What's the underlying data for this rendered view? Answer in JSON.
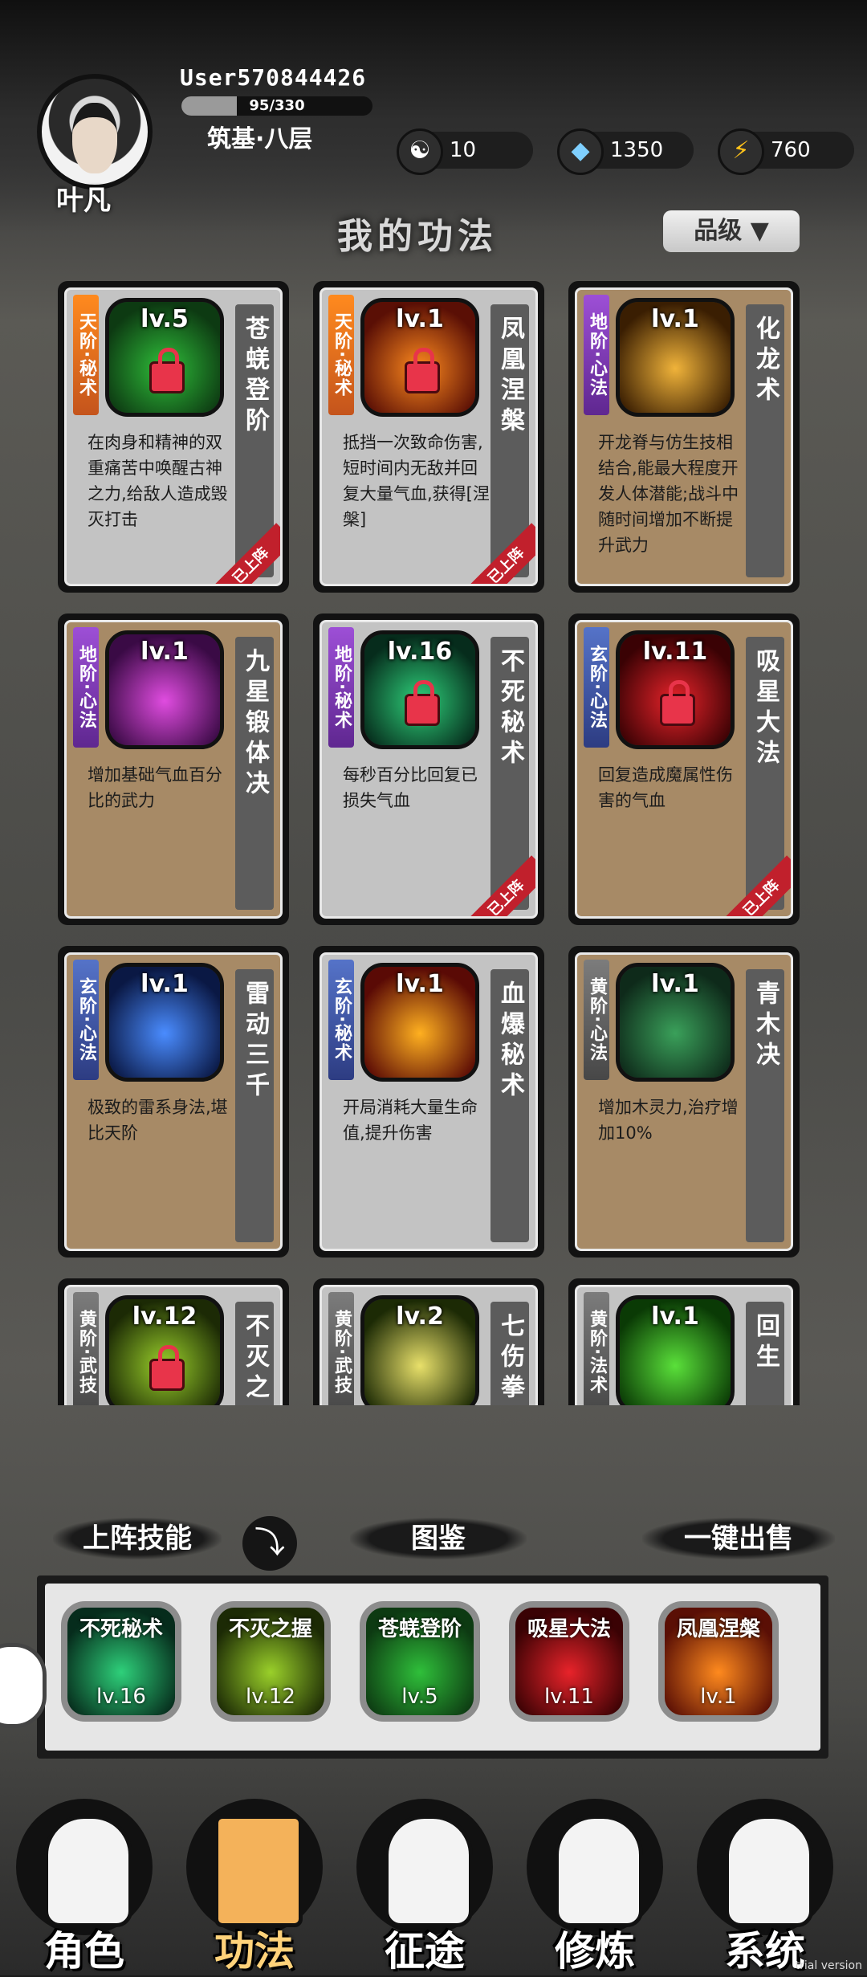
{
  "player": {
    "name": "叶凡",
    "user_id": "User570844426",
    "xp_text": "95/330",
    "xp_progress": 0.288,
    "realm": "筑基·八层"
  },
  "resources": [
    {
      "icon": "yin-yang-icon",
      "value": "10"
    },
    {
      "icon": "crystal-icon",
      "value": "1350"
    },
    {
      "icon": "lightning-icon",
      "value": "760"
    }
  ],
  "page_title": "我的功法",
  "grade_filter": "品级",
  "cards": [
    {
      "ribbon": "天阶·秘术",
      "tier": "tian",
      "level": "lv.5",
      "name": "苍蜣登阶",
      "desc": "在肉身和精神的双重痛苦中唤醒古神之力,给敌人造成毁灭打击",
      "bg": "gray",
      "locked": true,
      "equipped": true,
      "art": [
        "#0d3a12",
        "#2fbf3a"
      ]
    },
    {
      "ribbon": "天阶·秘术",
      "tier": "tian",
      "level": "lv.1",
      "name": "凤凰涅槃",
      "desc": "抵挡一次致命伤害,短时间内无敌并回复大量气血,获得[涅槃]",
      "bg": "gray",
      "locked": true,
      "equipped": true,
      "art": [
        "#5a0f05",
        "#ff8a1e"
      ]
    },
    {
      "ribbon": "地阶·心法",
      "tier": "di",
      "level": "lv.1",
      "name": "化龙术",
      "desc": "开龙脊与仿生技相结合,能最大程度开发人体潜能;战斗中随时间增加不断提升武力",
      "bg": "tan",
      "locked": false,
      "equipped": false,
      "art": [
        "#3a1e02",
        "#f0b33a"
      ]
    },
    {
      "ribbon": "地阶·心法",
      "tier": "di",
      "level": "lv.1",
      "name": "九星锻体决",
      "desc": "增加基础气血百分比的武力",
      "bg": "tan",
      "locked": false,
      "equipped": false,
      "art": [
        "#3a0a45",
        "#e04ce0"
      ]
    },
    {
      "ribbon": "地阶·秘术",
      "tier": "di",
      "level": "lv.16",
      "name": "不死秘术",
      "desc": "每秒百分比回复已损失气血",
      "bg": "gray",
      "locked": true,
      "equipped": true,
      "art": [
        "#062c1c",
        "#2ed07a"
      ]
    },
    {
      "ribbon": "玄阶·心法",
      "tier": "xuan",
      "level": "lv.11",
      "name": "吸星大法",
      "desc": "回复造成魔属性伤害的气血",
      "bg": "tan",
      "locked": true,
      "equipped": true,
      "art": [
        "#3a0204",
        "#e8232a"
      ]
    },
    {
      "ribbon": "玄阶·心法",
      "tier": "xuan",
      "level": "lv.1",
      "name": "雷动三千",
      "desc": "极致的雷系身法,堪比天阶",
      "bg": "tan",
      "locked": false,
      "equipped": false,
      "art": [
        "#0a1844",
        "#4a8cff"
      ]
    },
    {
      "ribbon": "玄阶·秘术",
      "tier": "xuan",
      "level": "lv.1",
      "name": "血爆秘术",
      "desc": "开局消耗大量生命值,提升伤害",
      "bg": "gray",
      "locked": false,
      "equipped": false,
      "art": [
        "#5a0a05",
        "#ffb020"
      ]
    },
    {
      "ribbon": "黄阶·心法",
      "tier": "huang",
      "level": "lv.1",
      "name": "青木决",
      "desc": "增加木灵力,治疗增加10%",
      "bg": "tan",
      "locked": false,
      "equipped": false,
      "art": [
        "#0e2a1a",
        "#3aa05a"
      ]
    },
    {
      "ribbon": "黄阶·武技",
      "tier": "huang",
      "level": "lv.12",
      "name": "不灭之",
      "desc": "",
      "bg": "gray",
      "locked": true,
      "equipped": false,
      "art": [
        "#1c2a05",
        "#9ad02a"
      ]
    },
    {
      "ribbon": "黄阶·武技",
      "tier": "huang",
      "level": "lv.2",
      "name": "七伤拳",
      "desc": "",
      "bg": "gray",
      "locked": false,
      "equipped": false,
      "art": [
        "#1c2a05",
        "#e8e06a"
      ]
    },
    {
      "ribbon": "黄阶·法术",
      "tier": "huang",
      "level": "lv.1",
      "name": "回生",
      "desc": "",
      "bg": "gray",
      "locked": false,
      "equipped": false,
      "art": [
        "#0a3a05",
        "#5ae03a"
      ]
    }
  ],
  "tabs": {
    "equipped": "上阵技能",
    "gallery": "图鉴",
    "sell_all": "一键出售"
  },
  "equipped_skills": [
    {
      "name": "不死秘术",
      "level": "lv.16",
      "art": [
        "#062c1c",
        "#2ed07a"
      ]
    },
    {
      "name": "不灭之握",
      "level": "lv.12",
      "art": [
        "#1c2a05",
        "#9ad02a"
      ]
    },
    {
      "name": "苍蜣登阶",
      "level": "lv.5",
      "art": [
        "#0d3a12",
        "#2fbf3a"
      ]
    },
    {
      "name": "吸星大法",
      "level": "lv.11",
      "art": [
        "#3a0204",
        "#e8232a"
      ]
    },
    {
      "name": "凤凰涅槃",
      "level": "lv.1",
      "art": [
        "#5a0f05",
        "#ff8a1e"
      ]
    }
  ],
  "equipped_badge": "已上阵",
  "nav": [
    {
      "label": "角色",
      "icon": "hooded-figure-icon",
      "active": false
    },
    {
      "label": "功法",
      "icon": "scroll-book-icon",
      "active": true
    },
    {
      "label": "征途",
      "icon": "sword-emblem-icon",
      "active": false
    },
    {
      "label": "修炼",
      "icon": "meditating-figure-icon",
      "active": false
    },
    {
      "label": "系统",
      "icon": "mascot-icon",
      "active": false
    }
  ],
  "watermark": "trial version"
}
